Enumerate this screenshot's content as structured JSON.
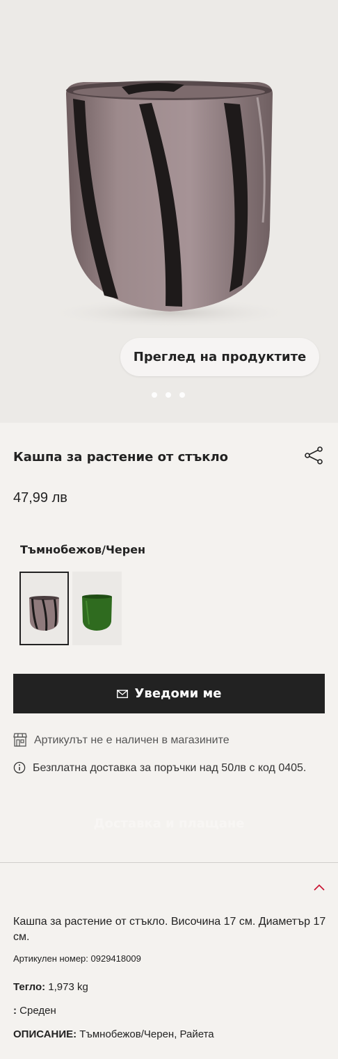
{
  "gallery": {
    "overview_button": "Преглед на продуктите",
    "dots": 3,
    "active_dot": 1
  },
  "product": {
    "title": "Кашпа за растение от стъкло",
    "price": "47,99 лв",
    "color_name": "Тъмнобежов/Черен"
  },
  "swatches": [
    {
      "color": "#8f7a7c",
      "stripe": "#1c1a1a",
      "selected": true
    },
    {
      "color": "#2f6b1f",
      "stripe": "#1f4d14",
      "selected": false
    }
  ],
  "actions": {
    "notify_label": "Уведоми ме"
  },
  "info": {
    "store_availability": "Артикулът не е наличен в магазините",
    "free_delivery": "Безплатна доставка за поръчки над 50лв с код 0405."
  },
  "delivery_section": {
    "label": "Доставка и плащане"
  },
  "description": {
    "text": "Кашпа за растение от стъкло. Височина 17 см. Диаметър 17 см.",
    "article_number": "Артикулен номер: 0929418009",
    "weight_label": "Тегло:",
    "weight_value": " 1,973 kg",
    "size_label": ":",
    "size_value": " Среден",
    "descr_label": "ОПИСАНИЕ:",
    "descr_value": " Тъмнобежов/Черен, Райета"
  },
  "colors": {
    "accent": "#c8102e",
    "button_bg": "#222222",
    "page_bg": "#f4f2ef"
  }
}
